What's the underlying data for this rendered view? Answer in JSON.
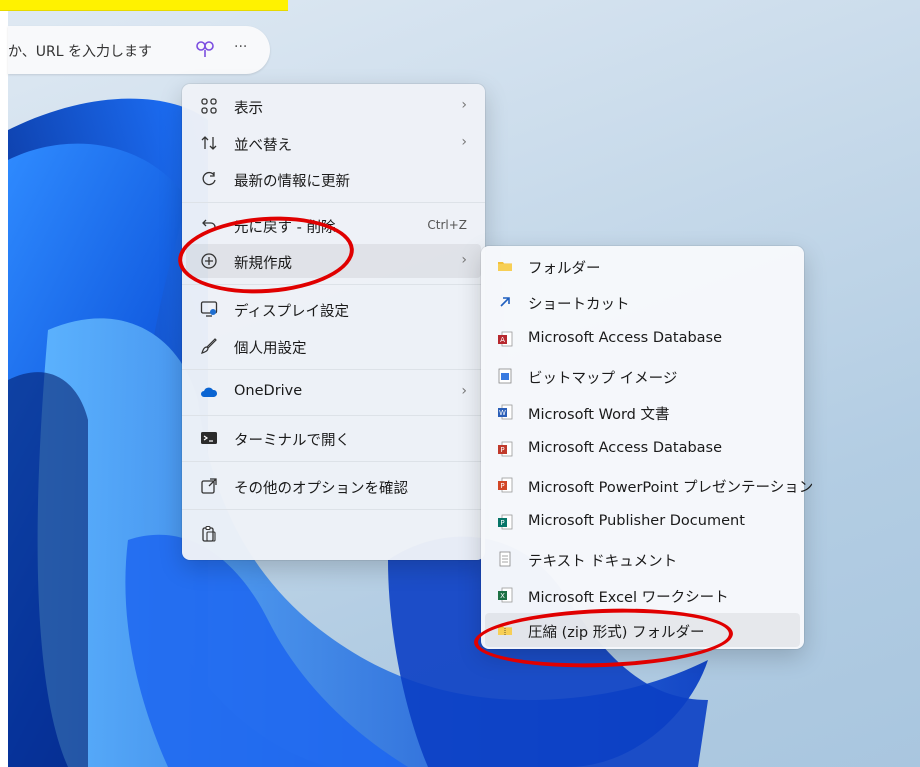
{
  "address_bar": {
    "text": "か、URL を入力します",
    "ellipsis": "···"
  },
  "context_menu": {
    "items": [
      {
        "label": "表示",
        "icon": "grid-view-icon",
        "submenu": true
      },
      {
        "label": "並べ替え",
        "icon": "sort-icon",
        "submenu": true
      },
      {
        "label": "最新の情報に更新",
        "icon": "refresh-icon"
      },
      {
        "label": "元に戻す - 削除",
        "icon": "undo-icon",
        "shortcut": "Ctrl+Z"
      },
      {
        "label": "新規作成",
        "icon": "plus-circle-icon",
        "submenu": true,
        "highlighted": true
      },
      {
        "label": "ディスプレイ設定",
        "icon": "display-settings-icon"
      },
      {
        "label": "個人用設定",
        "icon": "brush-icon"
      },
      {
        "label": "OneDrive",
        "icon": "onedrive-cloud-icon",
        "submenu": true
      },
      {
        "label": "ターミナルで開く",
        "icon": "terminal-icon"
      },
      {
        "label": "その他のオプションを確認",
        "icon": "more-options-icon"
      },
      {
        "label": "",
        "icon": "paste-icon"
      }
    ]
  },
  "new_submenu": {
    "items": [
      {
        "label": "フォルダー",
        "icon": "folder-icon"
      },
      {
        "label": "ショートカット",
        "icon": "shortcut-icon"
      },
      {
        "label": "Microsoft Access Database",
        "icon": "access-icon"
      },
      {
        "label": "ビットマップ イメージ",
        "icon": "bitmap-icon"
      },
      {
        "label": "Microsoft Word 文書",
        "icon": "word-icon"
      },
      {
        "label": "Microsoft Access Database",
        "icon": "access-icon"
      },
      {
        "label": "Microsoft PowerPoint プレゼンテーション",
        "icon": "powerpoint-icon"
      },
      {
        "label": "Microsoft Publisher Document",
        "icon": "publisher-icon"
      },
      {
        "label": "テキスト ドキュメント",
        "icon": "text-document-icon"
      },
      {
        "label": "Microsoft Excel ワークシート",
        "icon": "excel-icon"
      },
      {
        "label": "圧縮 (zip 形式) フォルダー",
        "icon": "zip-folder-icon",
        "highlighted": true
      }
    ]
  },
  "colors": {
    "annotation_ring": "#e00000",
    "highlight_bar": "#fff200",
    "wallpaper_blue": "#0a4fd8"
  }
}
